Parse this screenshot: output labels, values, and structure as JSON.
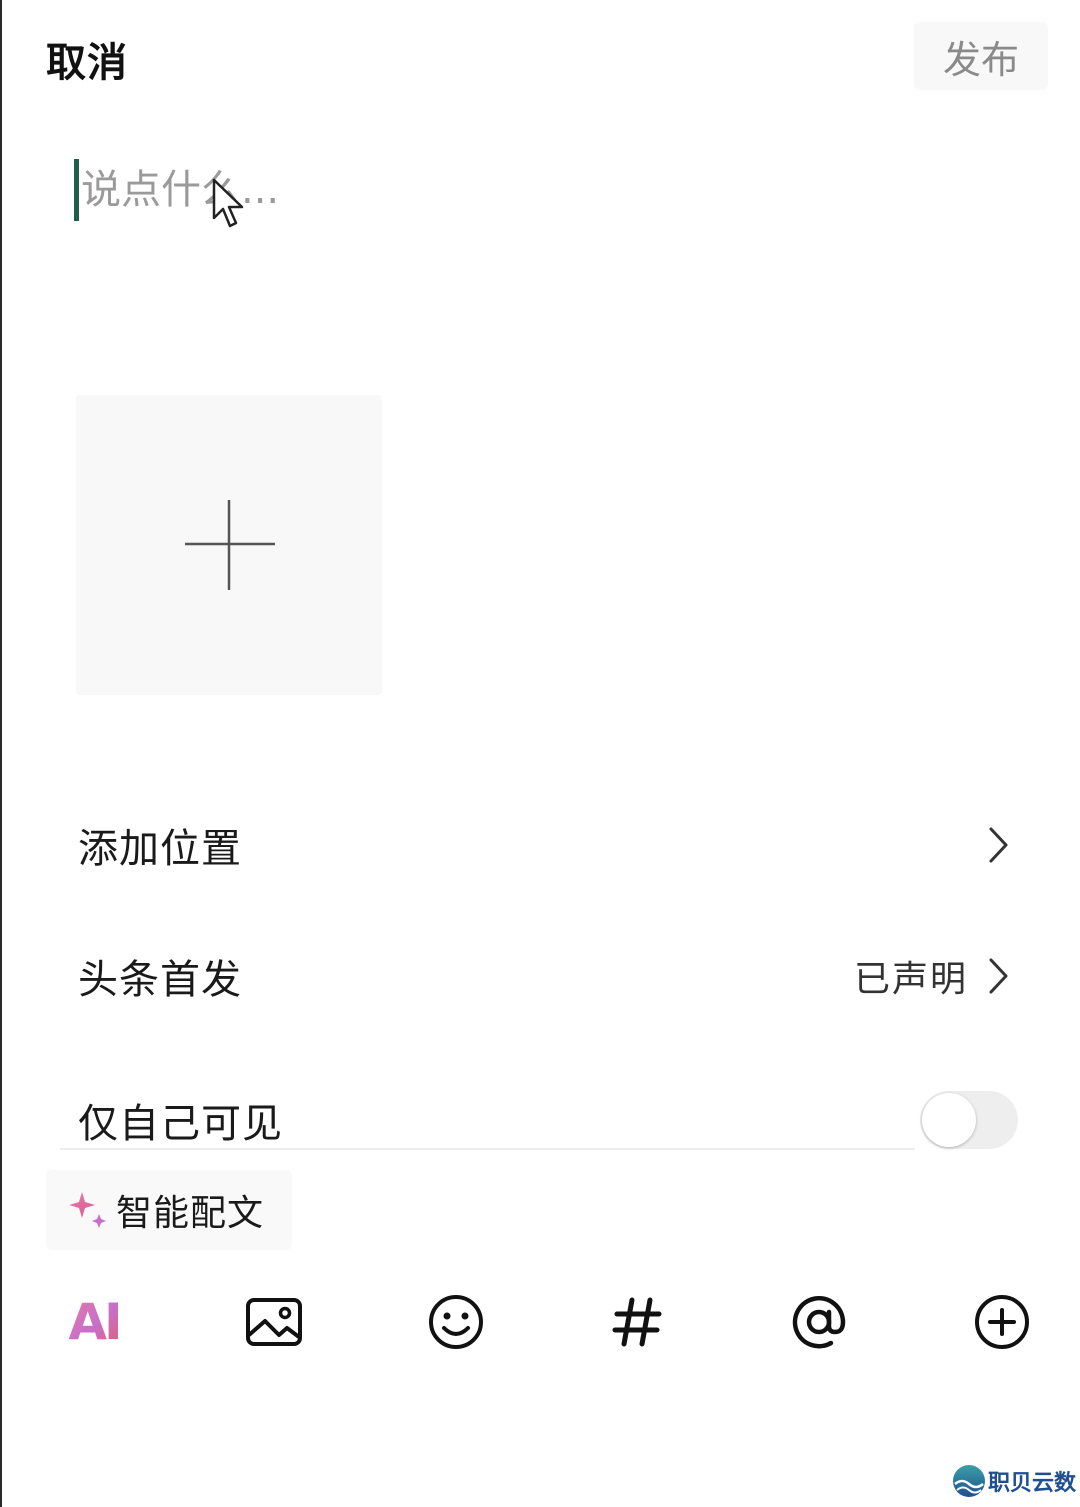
{
  "header": {
    "cancel_label": "取消",
    "publish_label": "发布"
  },
  "compose": {
    "placeholder": "说点什么..."
  },
  "options": {
    "location_label": "添加位置",
    "first_publish_label": "头条首发",
    "first_publish_value": "已声明",
    "private_label": "仅自己可见",
    "private_enabled": false
  },
  "smart": {
    "label": "智能配文"
  },
  "toolbar": {
    "ai_label": "AI",
    "icons": [
      "image-icon",
      "emoji-icon",
      "hashtag-icon",
      "mention-icon",
      "plus-circle-icon"
    ]
  },
  "watermark": {
    "text": "职贝云数"
  },
  "colors": {
    "caret": "#1f5f4a",
    "publish_text": "#8a8a8a",
    "ai_gradient_start": "#e67aa8",
    "ai_gradient_end": "#e35e6e"
  }
}
